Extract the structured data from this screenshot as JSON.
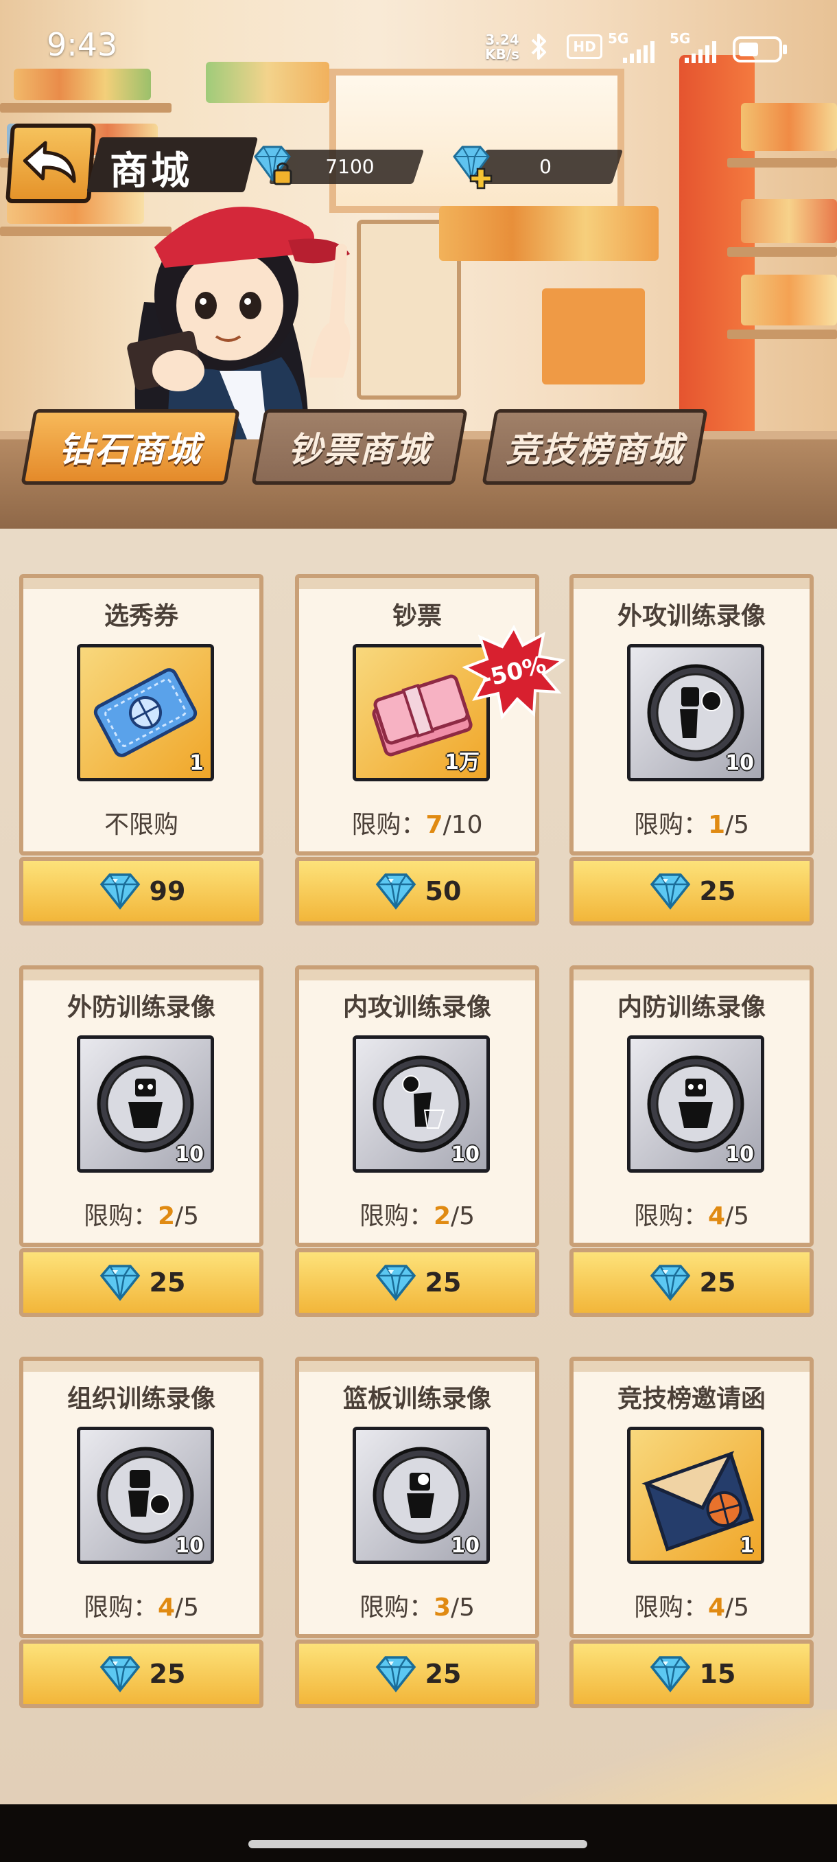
{
  "status_bar": {
    "time": "9:43",
    "net_speed_value": "3.24",
    "net_speed_unit": "KB/s",
    "hd_label": "HD",
    "signal_1": "5G",
    "signal_2": "5G"
  },
  "header": {
    "title": "商城",
    "currencies": [
      {
        "name": "locked-diamond",
        "value": "7100"
      },
      {
        "name": "diamond-add",
        "value": "0"
      }
    ]
  },
  "tabs": [
    {
      "label": "钻石商城",
      "active": true
    },
    {
      "label": "钞票商城",
      "active": false
    },
    {
      "label": "竞技榜商城",
      "active": false
    }
  ],
  "items": [
    {
      "name": "选秀券",
      "qty": "1",
      "icon": "ticket-icon",
      "style": "gold",
      "limit_text": "不限购",
      "price": "99"
    },
    {
      "name": "钞票",
      "qty": "1万",
      "icon": "cash-icon",
      "style": "gold",
      "limit_prefix": "限购：",
      "limit_current": "7",
      "limit_max": "/10",
      "price": "50",
      "discount": "-50%"
    },
    {
      "name": "外攻训练录像",
      "qty": "10",
      "icon": "outside-attack-record-icon",
      "style": "silver",
      "limit_prefix": "限购：",
      "limit_current": "1",
      "limit_max": "/5",
      "price": "25"
    },
    {
      "name": "外防训练录像",
      "qty": "10",
      "icon": "outside-defense-record-icon",
      "style": "silver",
      "limit_prefix": "限购：",
      "limit_current": "2",
      "limit_max": "/5",
      "price": "25"
    },
    {
      "name": "内攻训练录像",
      "qty": "10",
      "icon": "inside-attack-record-icon",
      "style": "silver",
      "limit_prefix": "限购：",
      "limit_current": "2",
      "limit_max": "/5",
      "price": "25"
    },
    {
      "name": "内防训练录像",
      "qty": "10",
      "icon": "inside-defense-record-icon",
      "style": "silver",
      "limit_prefix": "限购：",
      "limit_current": "4",
      "limit_max": "/5",
      "price": "25"
    },
    {
      "name": "组织训练录像",
      "qty": "10",
      "icon": "playmaking-record-icon",
      "style": "silver",
      "limit_prefix": "限购：",
      "limit_current": "4",
      "limit_max": "/5",
      "price": "25"
    },
    {
      "name": "篮板训练录像",
      "qty": "10",
      "icon": "rebound-record-icon",
      "style": "silver",
      "limit_prefix": "限购：",
      "limit_current": "3",
      "limit_max": "/5",
      "price": "25"
    },
    {
      "name": "竞技榜邀请函",
      "qty": "1",
      "icon": "invitation-letter-icon",
      "style": "gold",
      "limit_prefix": "限购：",
      "limit_current": "4",
      "limit_max": "/5",
      "price": "15"
    }
  ],
  "colors": {
    "accent_orange": "#e08a12",
    "tab_active": "#f0a03f",
    "buy_button": "#f5c84f"
  }
}
